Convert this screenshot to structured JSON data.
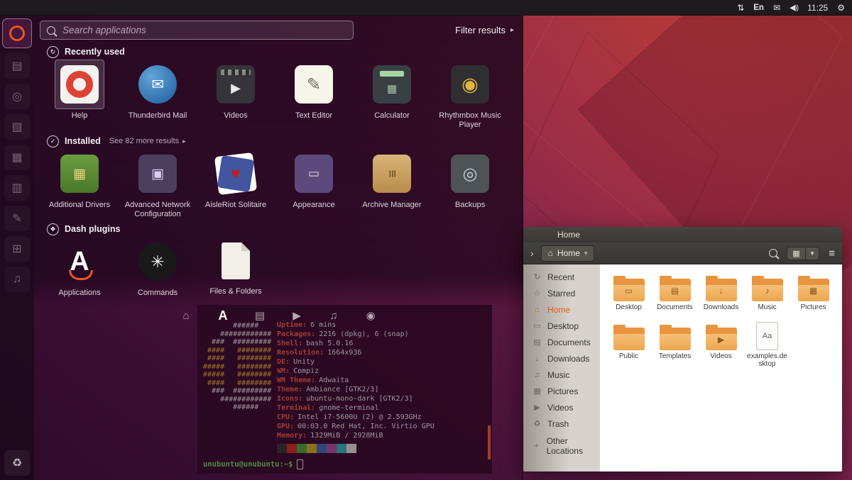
{
  "colors": {
    "accent": "#e95420",
    "terminal_bg": "#300a24",
    "folder": "#e9953f"
  },
  "panel": {
    "network_icon": "⇅",
    "keyboard_label": "En",
    "mail_icon": "✉",
    "volume_icon": "◀))",
    "clock": "11:25",
    "session_icon": "⚙"
  },
  "launcher": {
    "items": [
      {
        "name": "dash-home",
        "cls": "icon-bfb",
        "glyph": ""
      },
      {
        "name": "file-manager",
        "glyph": "▤"
      },
      {
        "name": "software-center",
        "glyph": "◎"
      },
      {
        "name": "writer",
        "glyph": "▧"
      },
      {
        "name": "spreadsheet",
        "glyph": "▦"
      },
      {
        "name": "presentation",
        "glyph": "▥"
      },
      {
        "name": "text-editor",
        "glyph": "✎"
      },
      {
        "name": "workspace-switcher",
        "glyph": "⊞"
      },
      {
        "name": "music-player",
        "glyph": "♫"
      }
    ],
    "trash": {
      "name": "trash",
      "glyph": "♻"
    }
  },
  "dash": {
    "search": {
      "placeholder": "Search applications",
      "filter_label": "Filter results",
      "filter_caret": "▸"
    },
    "sections": {
      "recent": {
        "icon": "↻",
        "title": "Recently used",
        "apps": [
          {
            "label": "Help",
            "cls": "icon-help",
            "glyph": "",
            "sel_cls": "selected"
          },
          {
            "label": "Thunderbird Mail",
            "cls": "icon-tbird",
            "glyph": "✉"
          },
          {
            "label": "Videos",
            "cls": "icon-videos",
            "glyph": "▶"
          },
          {
            "label": "Text Editor",
            "cls": "icon-gedit",
            "glyph": "✎"
          },
          {
            "label": "Calculator",
            "cls": "icon-calc",
            "glyph": "▦"
          },
          {
            "label": "Rhythmbox Music Player",
            "cls": "icon-rhythm",
            "glyph": "◉"
          }
        ]
      },
      "installed": {
        "icon": "✓",
        "title": "Installed",
        "link": "See 82 more results",
        "link_caret": "▸",
        "apps": [
          {
            "label": "Additional Drivers",
            "cls": "icon-drivers",
            "glyph": "▦"
          },
          {
            "label": "Advanced Network Configuration",
            "cls": "icon-network",
            "glyph": "▣"
          },
          {
            "label": "AisleRiot Solitaire",
            "cls": "icon-cards",
            "glyph": "♥"
          },
          {
            "label": "Appearance",
            "cls": "icon-appearance",
            "glyph": "▭"
          },
          {
            "label": "Archive Manager",
            "cls": "icon-archive",
            "glyph": "≡"
          },
          {
            "label": "Backups",
            "cls": "icon-backups",
            "glyph": "◎"
          }
        ]
      },
      "plugins": {
        "icon": "❖",
        "title": "Dash plugins",
        "apps": [
          {
            "label": "Applications",
            "cls": "icon-apps-lens",
            "glyph": "A"
          },
          {
            "label": "Commands",
            "cls": "icon-commands",
            "glyph": "✳"
          },
          {
            "label": "Files & Folders",
            "cls": "icon-files-lens",
            "glyph": ""
          }
        ]
      }
    },
    "lenses": [
      {
        "name": "home-lens",
        "glyph": "⌂"
      },
      {
        "name": "applications-lens",
        "glyph": "A",
        "cls": "active"
      },
      {
        "name": "files-lens",
        "glyph": "▤"
      },
      {
        "name": "video-lens",
        "glyph": "▶"
      },
      {
        "name": "music-lens",
        "glyph": "♫"
      },
      {
        "name": "photos-lens",
        "glyph": "◉"
      }
    ]
  },
  "terminal": {
    "ascii": [
      {
        "t": "       ######",
        "c": "w"
      },
      {
        "t": "    ############",
        "c": "w"
      },
      {
        "t": "  ###  #########",
        "c": "w"
      },
      {
        "t": " ####   ########",
        "c": "g"
      },
      {
        "t": " ####   ########",
        "c": "g"
      },
      {
        "t": "#####   ########",
        "c": "g"
      },
      {
        "t": "#####   ########",
        "c": "g"
      },
      {
        "t": " ####   ########",
        "c": "g"
      },
      {
        "t": "  ###  #########",
        "c": "w"
      },
      {
        "t": "    ############",
        "c": "w"
      },
      {
        "t": "       ######",
        "c": "w"
      }
    ],
    "info": [
      {
        "label": "Uptime:",
        "value": "6 mins"
      },
      {
        "label": "Packages:",
        "value": "2216 (dpkg), 6 (snap)"
      },
      {
        "label": "Shell:",
        "value": "bash 5.0.16"
      },
      {
        "label": "Resolution:",
        "value": "1664x936"
      },
      {
        "label": "DE:",
        "value": "Unity"
      },
      {
        "label": "WM:",
        "value": "Compiz"
      },
      {
        "label": "WM Theme:",
        "value": "Adwaita"
      },
      {
        "label": "Theme:",
        "value": "Ambiance [GTK2/3]"
      },
      {
        "label": "Icons:",
        "value": "ubuntu-mono-dark [GTK2/3]"
      },
      {
        "label": "Terminal:",
        "value": "gnome-terminal"
      },
      {
        "label": "CPU:",
        "value": "Intel i7-5600U (2) @ 2.593GHz"
      },
      {
        "label": "GPU:",
        "value": "00:03.0 Red Hat, Inc. Virtio GPU"
      },
      {
        "label": "Memory:",
        "value": "1329MiB / 2928MiB"
      }
    ],
    "palette": [
      "#30302e",
      "#c22a1c",
      "#3f9c35",
      "#c7a113",
      "#3465a4",
      "#9c4d8f",
      "#2fa8a8",
      "#d3d0c9"
    ],
    "prompt": "unubuntu@unubuntu:~$"
  },
  "files": {
    "title": "Home",
    "toolbar": {
      "back_icon": "›",
      "path_home_icon": "⌂",
      "path_label": "Home",
      "path_caret": "▾",
      "view_icon": "▦",
      "view_caret": "▾",
      "menu_icon": "≡"
    },
    "sidebar": [
      {
        "glyph": "↻",
        "label": "Recent"
      },
      {
        "glyph": "☆",
        "label": "Starred"
      },
      {
        "glyph": "⌂",
        "label": "Home",
        "cls": "active"
      },
      {
        "glyph": "▭",
        "label": "Desktop"
      },
      {
        "glyph": "▤",
        "label": "Documents"
      },
      {
        "glyph": "↓",
        "label": "Downloads"
      },
      {
        "glyph": "♫",
        "label": "Music"
      },
      {
        "glyph": "▦",
        "label": "Pictures"
      },
      {
        "glyph": "▶",
        "label": "Videos"
      },
      {
        "glyph": "♻",
        "label": "Trash"
      },
      {
        "glyph": "+",
        "label": "Other Locations",
        "cls": "last"
      }
    ],
    "items": [
      {
        "label": "Desktop",
        "type": "folder",
        "emblem": "▭"
      },
      {
        "label": "Documents",
        "type": "folder",
        "emblem": "▤"
      },
      {
        "label": "Downloads",
        "type": "folder",
        "emblem": "↓"
      },
      {
        "label": "Music",
        "type": "folder",
        "emblem": "♪"
      },
      {
        "label": "Pictures",
        "type": "folder",
        "emblem": "▦"
      },
      {
        "label": "Public",
        "type": "folder",
        "emblem": ""
      },
      {
        "label": "Templates",
        "type": "folder",
        "emblem": ""
      },
      {
        "label": "Videos",
        "type": "folder",
        "emblem": "▶"
      },
      {
        "label": "examples.desktop",
        "type": "file",
        "emblem": "Aa"
      }
    ]
  }
}
